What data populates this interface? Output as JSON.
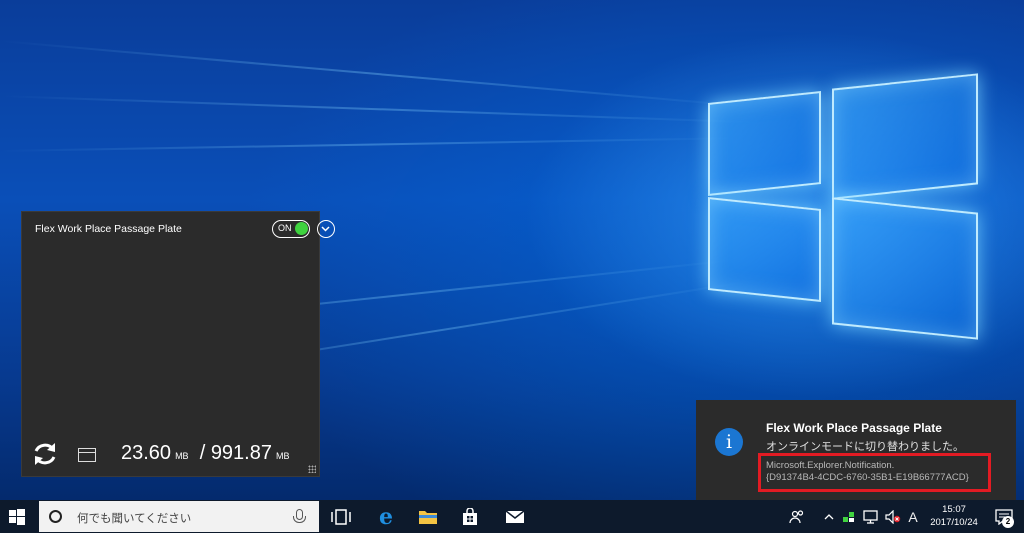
{
  "desktop": {
    "name": "Windows 10 desktop"
  },
  "widget": {
    "title": "Flex Work Place Passage Plate",
    "toggle_label": "ON",
    "usage_used": "23.60",
    "usage_used_unit": "MB",
    "usage_separator": "/",
    "usage_total": "991.87",
    "usage_total_unit": "MB"
  },
  "toast": {
    "icon_glyph": "i",
    "title": "Flex Work Place Passage Plate",
    "body": "オンラインモードに切り替わりました。",
    "source_line1": "Microsoft.Explorer.Notification.",
    "source_line2": "{D91374B4-4CDC-6760-35B1-E19B66777ACD}",
    "highlight_color": "#e31b23"
  },
  "taskbar": {
    "search_placeholder": "何でも聞いてください",
    "ime_indicator": "A",
    "clock_time": "15:07",
    "clock_date": "2017/10/24",
    "notification_count": "2",
    "icons": [
      "start-icon",
      "cortana-icon",
      "microphone-icon",
      "task-view-icon",
      "edge-icon",
      "file-explorer-icon",
      "store-icon",
      "mail-icon",
      "people-icon",
      "show-hidden-icons-chevron",
      "app-tray-icon",
      "network-icon",
      "volume-muted-icon",
      "action-center-icon"
    ]
  },
  "colors": {
    "accent_blue": "#1b76d2",
    "toggle_on": "#3fd33f",
    "taskbar_bg": "#0d1a2c"
  }
}
